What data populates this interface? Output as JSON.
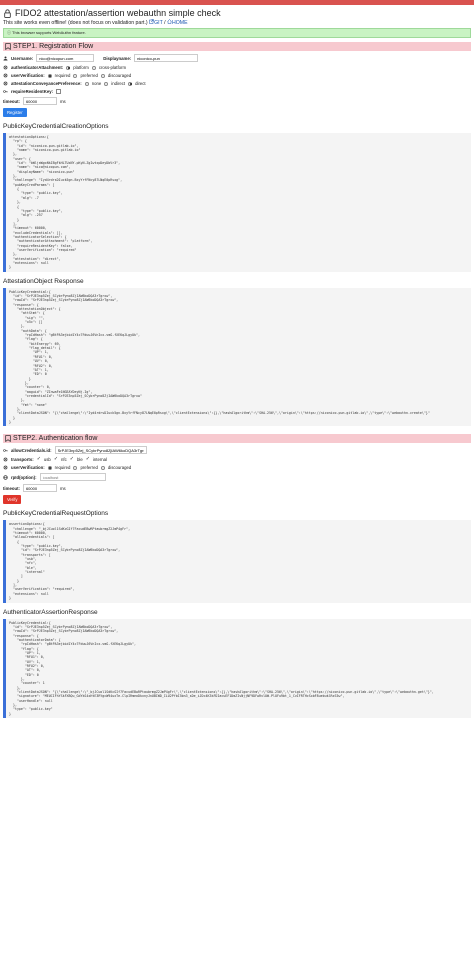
{
  "header": {
    "title": "FIDO2 attestation/assertion webauthn simple check",
    "subtitle": "This site works even offline! (does not focus on validation part.)",
    "git_link": "GIT",
    "home_link": "HOME",
    "support_message": "This browser supports WebAuthn feature.",
    "accent_color": "#d9534f"
  },
  "step1": {
    "title": "STEP1. Registration Flow",
    "username_label": "Username:",
    "username_value": "nico@nicopun.com",
    "displayname_label": "Displayname:",
    "displayname_value": "niconico-pun",
    "attachment_label": "authenticatorAttachment:",
    "attachment_options": [
      "platform",
      "cross-platform"
    ],
    "attachment_selected": 0,
    "uv_label": "userVerification:",
    "uv_options": [
      "required",
      "preferred",
      "discouraged"
    ],
    "uv_selected": 0,
    "conveyance_label": "attestationConveyancePreference:",
    "conveyance_options": [
      "none",
      "indirect",
      "direct"
    ],
    "conveyance_selected": 2,
    "resident_label": "requireResidentKey:",
    "timeout_label": "timeout:",
    "timeout_value": "60000",
    "timeout_unit": "ms",
    "button_label": "Register",
    "options_title": "PublicKeyCredentialCreationOptions",
    "options_json": "attestationOptions:{\n  \"rp\": {\n    \"id\": \"niconico-pun.gitlab.io\",\n    \"name\": \"niconico-pun.gitlab.io\"\n  },\n  \"user\": {\n    \"id\": \"bWljaWgxNkIBgFkHLTUxNY-pKyN-ZgIwtxpDeyDbVr3\",\n    \"name\": \"nico@nicopun.com\",\n    \"displayName\": \"niconico-pun\"\n  },\n  \"challenge\": \"Iyd4rdrsDIuck5gn-BxyYrfFNcy87LNqE0pRsxg\",\n  \"pubKeyCredParams\": [\n    {\n      \"type\": \"public-key\",\n      \"alg\": -7\n    },\n    {\n      \"type\": \"public-key\",\n      \"alg\": -257\n    }\n  ],\n  \"timeout\": 60000,\n  \"excludeCredentials\": [],\n  \"authenticatorSelection\": {\n    \"authenticatorAttachment\": \"platform\",\n    \"requireResidentKey\": false,\n    \"userVerification\": \"required\"\n  },\n  \"attestation\": \"direct\",\n  \"extensions\": null\n}",
    "response_title": "AttestationObject Response",
    "response_json": "PublicKeyCredential:{\n  \"id\": \"SrPJE3np5Zej_SCybrPyno8ZjIAW6koDQA3rTgrxw\",\n  \"rawId\": \"SrPJE3np5Zej_SCybrPyno8ZjIAW6koDQA3rTgrxw\",\n  \"response\": {\n    \"attestationObject\": {\n      \"attStmt\": {\n        \"sig\": \"\",\n        \"x5c\": []\n      },\n      \"authData\": {\n        \"rpIdHash\": \"gBtPA3ejbid1Y4c7FduuJ6VnIcx-vmG-fXEKqJLgyUk\",\n        \"flag\": {\n          \"bitEnergy\": 69,\n          \"flag_detail\": {\n            \"UP\": 1,\n            \"RFU1\": 0,\n            \"UV\": 0,\n            \"RFU2\": 0,\n            \"AT\": 1,\n            \"ED\": 0\n          }\n        },\n        \"counter\": 0,\n        \"aaguid\": \"ZInwaFe1NGEAYDeyNj-Ig\",\n        \"credentialId\": \"SrPJE3np5Zej_SCybrPyno8ZjIAW6koDQA3rTgrxw\"\n      },\n      \"fmt\": \"none\"\n    },\n    \"clientDataJSON\": \"{\\\"challenge\\\":\\\"Iyd4rdrsDIuck5gn-BxyYrfFNcy87LNqE0pRsxg\\\",\\\"clientExtensions\\\":{},\\\"hashAlgorithm\\\":\\\"SHA-256\\\",\\\"origin\\\":\\\"https://niconico-pun.gitlab.io\\\",\\\"type\\\":\\\"webauthn.create\\\"}\"\n  }\n}"
  },
  "step2": {
    "title": "STEP2. Authentication flow",
    "allow_label": "allowCredentials.id:",
    "allow_value": "SrPJE3np5Zej_SCybrPyno8ZjIAW6koDQA3rTgrxw",
    "transports_label": "transports:",
    "transports": [
      "usb",
      "nfc",
      "ble",
      "internal"
    ],
    "uv_label": "userVerification:",
    "uv_options": [
      "required",
      "preferred",
      "discouraged"
    ],
    "uv_selected": 0,
    "rpid_label": "rpId(option):",
    "rpid_placeholder": "localhost",
    "timeout_label": "timeout:",
    "timeout_value": "60000",
    "timeout_unit": "ms",
    "button_label": "Verify",
    "options_title": "PublicKeyCredentialRequestOptions",
    "options_json": "assertionOptions:{\n  \"challenge\": \"_bjJCuol1SdKcGIf7FacudEBwRPtaubrmgZ2JmP4gFr\",\n  \"timeout\": 60000,\n  \"allowCredentials\": [\n    {\n      \"type\": \"public-key\",\n      \"id\": \"SrPJE3np5Zej_SCybrPyno8ZjIAW6koDQA3rTgrxw\",\n      \"transports\": [\n        \"usb\",\n        \"nfc\",\n        \"ble\",\n        \"internal\"\n      ]\n    }\n  ],\n  \"userVerification\": \"required\",\n  \"extensions\": null\n}",
    "response_title": "AuthenticatorAssertionResponse",
    "response_json": "PublicKeyCredential:{\n  \"id\": \"SrPJE3np5Zej_SCybrPyno8ZjIAW6koDQA3rTgrxw\",\n  \"rawId\": \"SrPJE3np5Zej_SCybrPyno8ZjIAW6koDQA3rTgrxw\",\n  \"response\": {\n    \"authenticatorData\": {\n      \"rpIdHash\": \"gBtPA3ejbid1Y4c7FduuJ6VnIcx-vmG-fXEKqJLgyUk\",\n      \"flag\": {\n        \"UP\": 1,\n        \"RFU1\": 0,\n        \"UV\": 1,\n        \"RFU2\": 0,\n        \"AT\": 0,\n        \"ED\": 0\n      },\n      \"counter\": 1\n    },\n    \"clientDataJSON\": \"{\\\"challenge\\\":\\\"_bjJCuol1SdKcGIf7FacudEBwRPtaubrmgZ2JmP4gFr\\\",\\\"clientExtensions\\\":{},\\\"hashAlgorithm\\\":\\\"SHA-256\\\",\\\"origin\\\":\\\"https://niconico-pun.gitlab.io\\\",\\\"type\\\":\\\"webauthn.get\\\"}\",\n    \"signature\": \"MEUCIFhYSkFXBQu_GdYkS4xHtE3RYgcW94uxTe-ClpIRmeoDkxnyJnUBIWD_ILU2PfbI5bn3_sDe_iJDc4K3kFDIacuEF1DmZIsNjjNF9DFwRvlOW-PlOFu9bt_1_CvIFRTHcSxbF8uebuklRxS5w\",\n    \"userHandle\": null\n  },\n  \"type\": \"public-key\"\n}"
  }
}
